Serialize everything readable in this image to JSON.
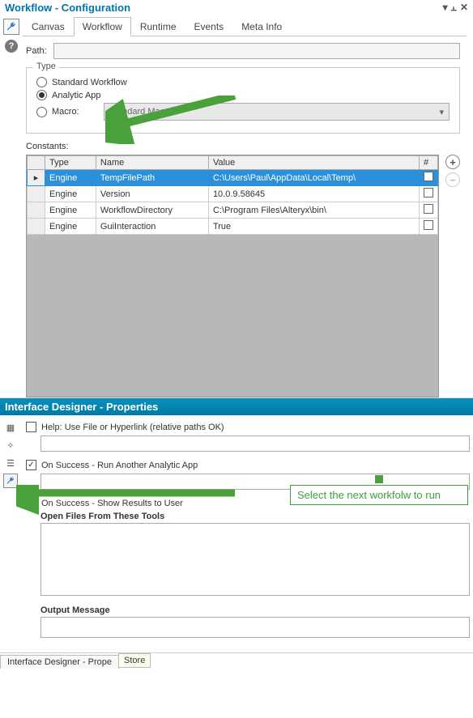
{
  "top_panel": {
    "title": "Workflow - Configuration",
    "tabs": [
      "Canvas",
      "Workflow",
      "Runtime",
      "Events",
      "Meta Info"
    ],
    "active_tab": "Workflow",
    "path_label": "Path:",
    "type_group": {
      "legend": "Type",
      "options": {
        "standard": "Standard Workflow",
        "analytic": "Analytic App",
        "macro": "Macro:"
      },
      "selected": "analytic",
      "macro_dropdown": "Standard Macro"
    },
    "constants_label": "Constants:",
    "grid": {
      "headers": [
        "Type",
        "Name",
        "Value",
        "#"
      ],
      "rows": [
        {
          "type": "Engine",
          "name": "TempFilePath",
          "value": "C:\\Users\\Paul\\AppData\\Local\\Temp\\",
          "selected": true
        },
        {
          "type": "Engine",
          "name": "Version",
          "value": "10.0.9.58645",
          "selected": false
        },
        {
          "type": "Engine",
          "name": "WorkflowDirectory",
          "value": "C:\\Program Files\\Alteryx\\bin\\",
          "selected": false
        },
        {
          "type": "Engine",
          "name": "GuiInteraction",
          "value": "True",
          "selected": false
        }
      ]
    }
  },
  "bottom_panel": {
    "title": "Interface Designer - Properties",
    "help_label": "Help: Use File or Hyperlink (relative paths OK)",
    "on_success_run": "On Success - Run Another Analytic App",
    "on_success_results": "On Success - Show Results to User",
    "open_files_label": "Open Files From These Tools",
    "output_msg_label": "Output Message"
  },
  "annotation": "Select the next workfolw to run",
  "footer": {
    "tab1": "Interface Designer - Prope",
    "tab2": "Store"
  }
}
